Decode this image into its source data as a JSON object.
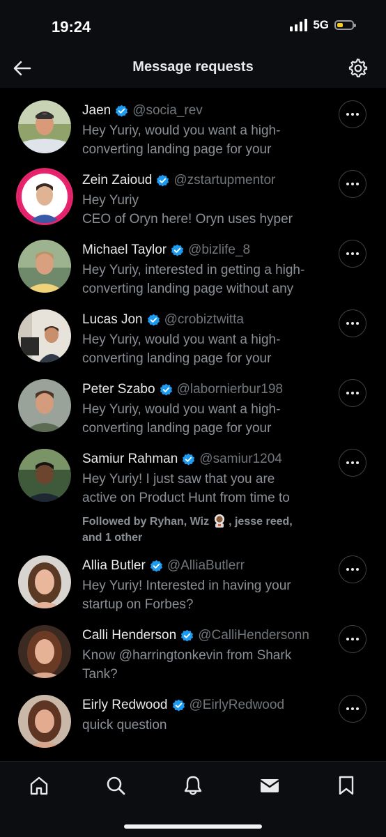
{
  "status_bar": {
    "time": "19:24",
    "network": "5G"
  },
  "header": {
    "title": "Message requests",
    "back_icon": "arrow-left-icon",
    "settings_icon": "gear-icon"
  },
  "requests": [
    {
      "name": "Jaen",
      "handle": "@socia_rev",
      "preview": [
        "Hey Yuriy, would you want a high-",
        "converting landing page for your"
      ]
    },
    {
      "name": "Zein Zaioud",
      "handle": "@zstartupmentor",
      "preview": [
        "Hey Yuriy",
        "CEO of Oryn here! Oryn uses hyper"
      ]
    },
    {
      "name": "Michael Taylor",
      "handle": "@bizlife_8",
      "preview": [
        "Hey Yuriy, interested in getting a high-",
        "converting landing page without any"
      ]
    },
    {
      "name": "Lucas Jon",
      "handle": "@crobiztwitta",
      "preview": [
        "Hey Yuriy, would you want a high-",
        "converting landing page for your"
      ]
    },
    {
      "name": "Peter Szabo",
      "handle": "@labornierbur198",
      "preview": [
        "Hey Yuriy, would you want a high-",
        "converting landing page for your"
      ]
    },
    {
      "name": "Samiur Rahman",
      "handle": "@samiur1204",
      "preview": [
        "Hey Yuriy! I just saw that you are",
        "active on Product Hunt from time to"
      ],
      "followed_by": [
        "Followed by Ryhan, Wiz",
        ", jesse reed,",
        "and 1 other"
      ]
    },
    {
      "name": "Allia Butler",
      "handle": "@AlliaButlerr",
      "preview": [
        "Hey Yuriy! Interested in having your",
        "startup on Forbes?"
      ]
    },
    {
      "name": "Calli Henderson",
      "handle": "@CalliHendersonn",
      "preview": [
        "Know @harringtonkevin from Shark",
        "Tank?"
      ]
    },
    {
      "name": "Eirly Redwood",
      "handle": "@EirlyRedwood",
      "preview": [
        "quick question"
      ]
    }
  ],
  "tabs": [
    {
      "name": "home",
      "icon": "home-icon"
    },
    {
      "name": "search",
      "icon": "search-icon"
    },
    {
      "name": "notifications",
      "icon": "bell-icon"
    },
    {
      "name": "messages",
      "icon": "mail-icon",
      "active": true
    },
    {
      "name": "bookmarks",
      "icon": "bookmark-icon"
    }
  ],
  "colors": {
    "background": "#000000",
    "text": "#e7e9ea",
    "muted": "#71767b",
    "verified": "#1d9bf0",
    "battery": "#f5d017"
  }
}
